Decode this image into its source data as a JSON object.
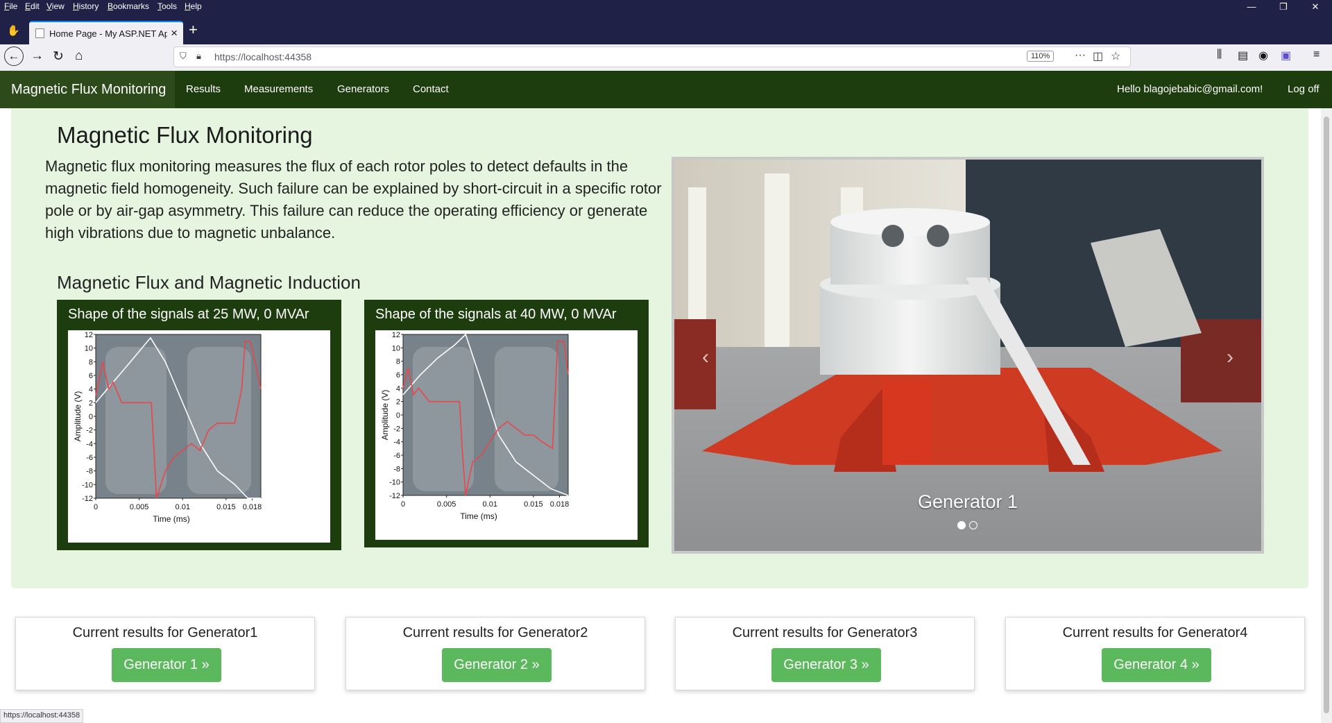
{
  "browser": {
    "menu": [
      "File",
      "Edit",
      "View",
      "History",
      "Bookmarks",
      "Tools",
      "Help"
    ],
    "tab_title": "Home Page - My ASP.NET Application",
    "url": "https://localhost:44358",
    "zoom": "110%",
    "status_url": "https://localhost:44358"
  },
  "site": {
    "brand": "Magnetic Flux Monitoring",
    "nav": [
      "Results",
      "Measurements",
      "Generators",
      "Contact"
    ],
    "greeting": "Hello blagojebabic@gmail.com!",
    "logoff": "Log off"
  },
  "jumbotron": {
    "title": "Magnetic Flux Monitoring",
    "text": "Magnetic flux monitoring measures the flux of each rotor poles to detect defaults in the magnetic field homogeneity. Such failure can be explained by short-circuit in a specific rotor pole or by air-gap asymmetry. This failure can reduce the operating efficiency or generate high vibrations due to magnetic unbalance.",
    "section_title": "Magnetic Flux and Magnetic Induction"
  },
  "signals": [
    {
      "caption": "Shape of the signals at 25 MW, 0 MVAr"
    },
    {
      "caption": "Shape of the signals at 40 MW, 0 MVAr"
    }
  ],
  "carousel": {
    "caption": "Generator 1",
    "slides": 2,
    "active": 0
  },
  "cards": [
    {
      "title": "Current results for Generator1",
      "button": "Generator 1 »"
    },
    {
      "title": "Current results for Generator2",
      "button": "Generator 2 »"
    },
    {
      "title": "Current results for Generator3",
      "button": "Generator 3 »"
    },
    {
      "title": "Current results for Generator4",
      "button": "Generator 4 »"
    }
  ],
  "chart_data": [
    {
      "type": "line",
      "title": "",
      "xlabel": "Time (ms)",
      "ylabel": "Amplitude (V)",
      "xlim": [
        0,
        0.019
      ],
      "ylim": [
        -12,
        12
      ],
      "x_ticks": [
        "0",
        "0.005",
        "0.01",
        "0.015",
        "0.018"
      ],
      "y_ticks": [
        "12",
        "10",
        "8",
        "6",
        "4",
        "2",
        "0",
        "-2",
        "-4",
        "-6",
        "-8",
        "-10",
        "-12"
      ],
      "series": [
        {
          "color": "#ffffff",
          "x": [
            0,
            0.002,
            0.004,
            0.0063,
            0.008,
            0.01,
            0.012,
            0.014,
            0.016,
            0.0175,
            0.019
          ],
          "y": [
            2,
            5,
            8,
            11.5,
            8,
            2,
            -4,
            -8,
            -10,
            -12,
            -12
          ]
        },
        {
          "color": "#e8474a",
          "x": [
            0,
            0.0008,
            0.0015,
            0.002,
            0.003,
            0.005,
            0.0064,
            0.0067,
            0.007,
            0.008,
            0.009,
            0.01,
            0.011,
            0.012,
            0.013,
            0.014,
            0.015,
            0.016,
            0.0168,
            0.0172,
            0.0178,
            0.019
          ],
          "y": [
            3,
            8,
            4,
            5,
            2,
            2,
            2,
            -5,
            -12,
            -8,
            -6,
            -5,
            -4,
            -5,
            -2,
            -1,
            -1,
            -1,
            4,
            11,
            11,
            4
          ]
        }
      ]
    },
    {
      "type": "line",
      "title": "",
      "xlabel": "Time (ms)",
      "ylabel": "Amplitude (V)",
      "xlim": [
        0,
        0.019
      ],
      "ylim": [
        -12,
        12
      ],
      "x_ticks": [
        "0",
        "0.005",
        "0.01",
        "0.015",
        "0.018"
      ],
      "y_ticks": [
        "12",
        "10",
        "8",
        "6",
        "4",
        "2",
        "0",
        "-2",
        "-4",
        "-6",
        "-8",
        "-10",
        "-12"
      ],
      "series": [
        {
          "color": "#ffffff",
          "x": [
            0,
            0.002,
            0.004,
            0.006,
            0.0072,
            0.009,
            0.011,
            0.013,
            0.015,
            0.017,
            0.019
          ],
          "y": [
            3,
            6,
            8.5,
            10.5,
            12,
            5,
            -3,
            -7,
            -9,
            -11,
            -12
          ]
        },
        {
          "color": "#e8474a",
          "x": [
            0,
            0.0006,
            0.0012,
            0.0018,
            0.003,
            0.005,
            0.0065,
            0.0068,
            0.0072,
            0.008,
            0.009,
            0.01,
            0.011,
            0.012,
            0.013,
            0.014,
            0.015,
            0.016,
            0.0172,
            0.0178,
            0.0185,
            0.019
          ],
          "y": [
            4,
            7,
            3,
            4,
            2,
            2,
            2,
            -5,
            -12,
            -7,
            -6,
            -4,
            -2,
            -1,
            -2,
            -3,
            -3,
            -4,
            -5,
            11,
            11,
            6
          ]
        }
      ]
    }
  ]
}
